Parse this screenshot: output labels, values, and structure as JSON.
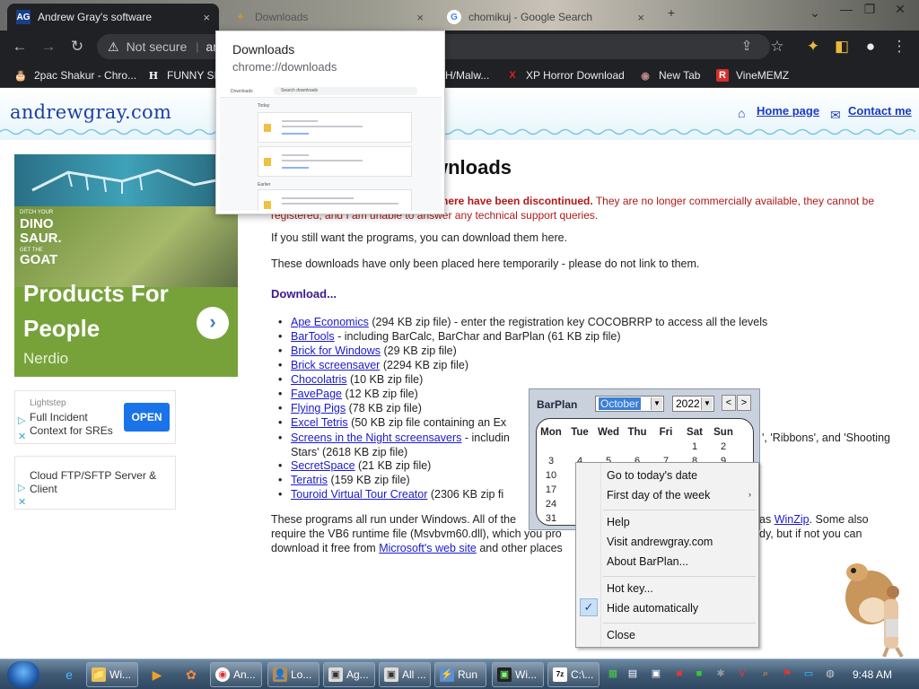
{
  "tabs": [
    {
      "icon": "AG",
      "label": "Andrew Gray's software",
      "close": "×"
    },
    {
      "label": "Downloads",
      "close": "×"
    },
    {
      "icon": "G",
      "label": "chomikuj - Google Search",
      "close": "×"
    }
  ],
  "new_tab": "+",
  "window_buttons": {
    "menu": "⌄",
    "minimize": "—",
    "restore": "❐",
    "close": "✕"
  },
  "toolbar": {
    "back": "←",
    "forward": "→",
    "reload": "↻",
    "not_secure": "Not secure",
    "url_partial": "an",
    "share": "⇪",
    "star": "☆",
    "extensions": "✦",
    "sidebar": "◧",
    "profile": "●",
    "menu": "⋮"
  },
  "bookmarks": [
    {
      "icon": "🎂",
      "label": "2pac Shakur - Chro..."
    },
    {
      "icon": "H",
      "label": "FUNNY SI"
    },
    {
      "icon": "",
      "label": "H/Malw..."
    },
    {
      "icon": "X",
      "label": "XP Horror Download"
    },
    {
      "icon": "◉",
      "label": "New Tab"
    },
    {
      "icon": "R",
      "label": "VineMEMZ"
    }
  ],
  "downloads_popup": {
    "title": "Downloads",
    "url": "chrome://downloads",
    "thumb_title": "Downloads",
    "thumb_search": "Search downloads",
    "thumb_today": "Today",
    "thumb_earlier": "Earlier"
  },
  "site": {
    "logo": "andrewgray.com",
    "home_link": "Home page",
    "contact_link": "Contact me"
  },
  "ads": {
    "big": {
      "small_top": "DITCH YOUR",
      "dino": "DINO\nSAUR.",
      "goat_small": "GET THE",
      "goat": "GOAT",
      "headline": "Products For People",
      "brand": "Nerdio",
      "arrow": "›"
    },
    "ad1": {
      "source": "Lightstep",
      "text": "Full Incident Context for SREs",
      "button": "OPEN"
    },
    "ad2": {
      "text": "Cloud FTP/SFTP Server & Client"
    }
  },
  "content": {
    "heading": "wnloads",
    "notice_bold": "s here have been discontinued.",
    "notice_rest": " They are no longer commercially available, they cannot be",
    "notice_line2": "registered, and I am unable to answer any technical support queries.",
    "para1": "If you still want the programs, you can download them here.",
    "para2": "These downloads have only been placed here temporarily - please do not link to them.",
    "download_heading": "Download...",
    "items": [
      {
        "link": "Ape Economics",
        "rest": " (294 KB zip file) - enter the registration key COCOBRRP to access all the levels"
      },
      {
        "link": "BarTools",
        "rest": " - including BarCalc, BarChar and BarPlan (61 KB zip file)"
      },
      {
        "link": "Brick for Windows",
        "rest": " (29 KB zip file)"
      },
      {
        "link": "Brick screensaver",
        "rest": " (2294 KB zip file)"
      },
      {
        "link": "Chocolatris",
        "rest": " (10 KB zip file)"
      },
      {
        "link": "FavePage",
        "rest": " (12 KB zip file)"
      },
      {
        "link": "Flying Pigs",
        "rest": " (78 KB zip file)"
      },
      {
        "link": "Excel Tetris",
        "rest": " (50 KB zip file containing an Ex"
      },
      {
        "link": "Screens in the Night screensavers",
        "rest": " - includin",
        "rest_right": "', 'Ribbons', and 'Shooting",
        "line2": "Stars' (2618 KB zip file)"
      },
      {
        "link": "SecretSpace",
        "rest": " (21 KB zip file)"
      },
      {
        "link": "Teratris",
        "rest": " (159 KB zip file)"
      },
      {
        "link": "Touroid Virtual Tour Creator",
        "rest": " (2306 KB zip fi"
      }
    ],
    "footer_l1": "These programs all run under Windows. All of the",
    "footer_l1_right": "as ",
    "footer_l1_link": "WinZip",
    "footer_l1_end": ". Some also",
    "footer_l2": "require the VB6 runtime file (Msvbvm60.dll), which you pro",
    "footer_l2_right": "dy, but if not you can",
    "footer_l3_a": "download it free from ",
    "footer_l3_link": "Microsoft's web site",
    "footer_l3_b": " and other places"
  },
  "barplan": {
    "title": "BarPlan",
    "month": "October",
    "year": "2022",
    "prev": "<",
    "next": ">",
    "days_of_week": [
      "Mon",
      "Tue",
      "Wed",
      "Thu",
      "Fri",
      "Sat",
      "Sun"
    ],
    "row1": [
      "",
      "",
      "",
      "",
      "",
      "1",
      "2"
    ],
    "row2": [
      "3",
      "4",
      "5",
      "6",
      "7",
      "8",
      "9"
    ],
    "row3_first": "10",
    "row4_first": "17",
    "row5_first": "24",
    "row6_first": "31"
  },
  "context_menu": {
    "items": [
      "Go to today's date",
      "First day of the week",
      "Help",
      "Visit andrewgray.com",
      "About BarPlan...",
      "Hot key...",
      "Hide automatically",
      "Close"
    ],
    "submenu_arrow": "›",
    "check": "✓"
  },
  "taskbar": {
    "buttons": [
      {
        "icon": "📁",
        "label": "Wi..."
      },
      {
        "icon": "🐚",
        "label": "An..."
      },
      {
        "icon": "👤",
        "label": "Lo..."
      },
      {
        "icon": "▣",
        "label": "Ag..."
      },
      {
        "icon": "▣",
        "label": "All ..."
      },
      {
        "icon": "⚡",
        "label": "Run"
      },
      {
        "icon": "▣",
        "label": "Wi..."
      },
      {
        "icon": "7z",
        "label": "C:\\..."
      }
    ],
    "clock": "9:48 AM"
  },
  "colors": {
    "accent_link": "#1a1acc",
    "notice_red": "#b01818",
    "download_heading": "#3a1a8c",
    "chrome_dark": "#202124"
  }
}
